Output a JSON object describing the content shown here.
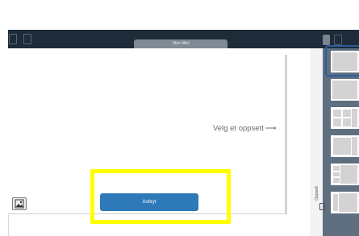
{
  "document": {
    "tab_title": "Uten tittel"
  },
  "canvas": {
    "hint_text": "Velg et oppsett",
    "hint_arrow": "⟶"
  },
  "dialog": {
    "cancel_label": "Avbryt"
  },
  "layout_panel": {
    "label": "Oppsett",
    "layouts": [
      "full",
      "full",
      "two-column",
      "split-right",
      "grid",
      "grid-small",
      "two-column-narrow"
    ]
  },
  "colors": {
    "toolbar": "#1e2b38",
    "accent": "#2e7ab9",
    "highlight": "#ffff00",
    "selection": "#2e5e9a"
  }
}
